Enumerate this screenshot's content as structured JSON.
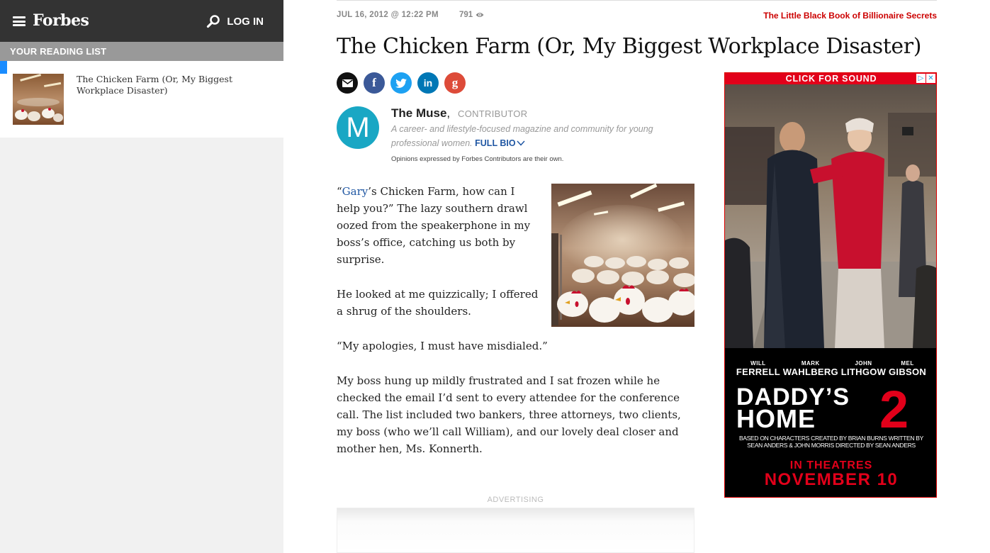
{
  "header": {
    "logo": "Forbes",
    "login_label": "LOG IN"
  },
  "reading_list": {
    "title": "YOUR READING LIST",
    "items": [
      {
        "title": "The Chicken Farm (Or, My Biggest Workplace Disaster)"
      }
    ]
  },
  "article": {
    "date": "JUL 16, 2012 @ 12:22 PM",
    "views": "791",
    "promo_link": "The Little Black Book of Billionaire Secrets",
    "title": "The Chicken Farm (Or, My Biggest Workplace Disaster)",
    "author": {
      "initial": "M",
      "name": "The Muse",
      "separator": ",",
      "role": "CONTRIBUTOR",
      "bio": "A career- and lifestyle-focused magazine and community for young professional women.",
      "full_bio_label": "FULL BIO",
      "disclaimer": "Opinions expressed by Forbes Contributors are their own."
    },
    "paragraphs": {
      "p1_open": "“",
      "p1_link": "Gary",
      "p1_rest": "’s Chicken Farm, how can I help you?” The lazy southern drawl oozed from the speakerphone in my boss’s office, catching us both by surprise.",
      "p2": "He looked at me quizzically; I offered a shrug of the shoulders.",
      "p3": "“My apologies, I must have misdialed.”",
      "p4": "My boss hung up mildly frustrated and I sat frozen while he checked the email I’d sent to every attendee for the conference call. The list included two bankers, three attorneys, two clients, my boss (who we’ll call William), and our lovely deal closer and mother hen, Ms. Konnerth."
    },
    "advertising_label": "ADVERTISING"
  },
  "ad": {
    "top_label": "CLICK FOR SOUND",
    "adchoices": "▷",
    "close": "✕",
    "cast": [
      {
        "first": "WILL",
        "last": "FERRELL"
      },
      {
        "first": "MARK",
        "last": "WAHLBERG"
      },
      {
        "first": "JOHN",
        "last": "LITHGOW"
      },
      {
        "first": "MEL",
        "last": "GIBSON"
      }
    ],
    "movie_title_line1": "DADDY’S",
    "movie_title_line2": "HOME",
    "movie_number": "2",
    "credits": "BASED ON CHARACTERS CREATED BY BRIAN BURNS   WRITTEN BY SEAN ANDERS & JOHN MORRIS   DIRECTED BY SEAN ANDERS",
    "release_line1": "IN THEATRES",
    "release_line2": "NOVEMBER 10"
  },
  "colors": {
    "topbar": "#333333",
    "link_blue": "#2057a3",
    "promo_red": "#cc0000",
    "ad_red": "#e2001a",
    "muse_teal": "#19a7c4"
  }
}
